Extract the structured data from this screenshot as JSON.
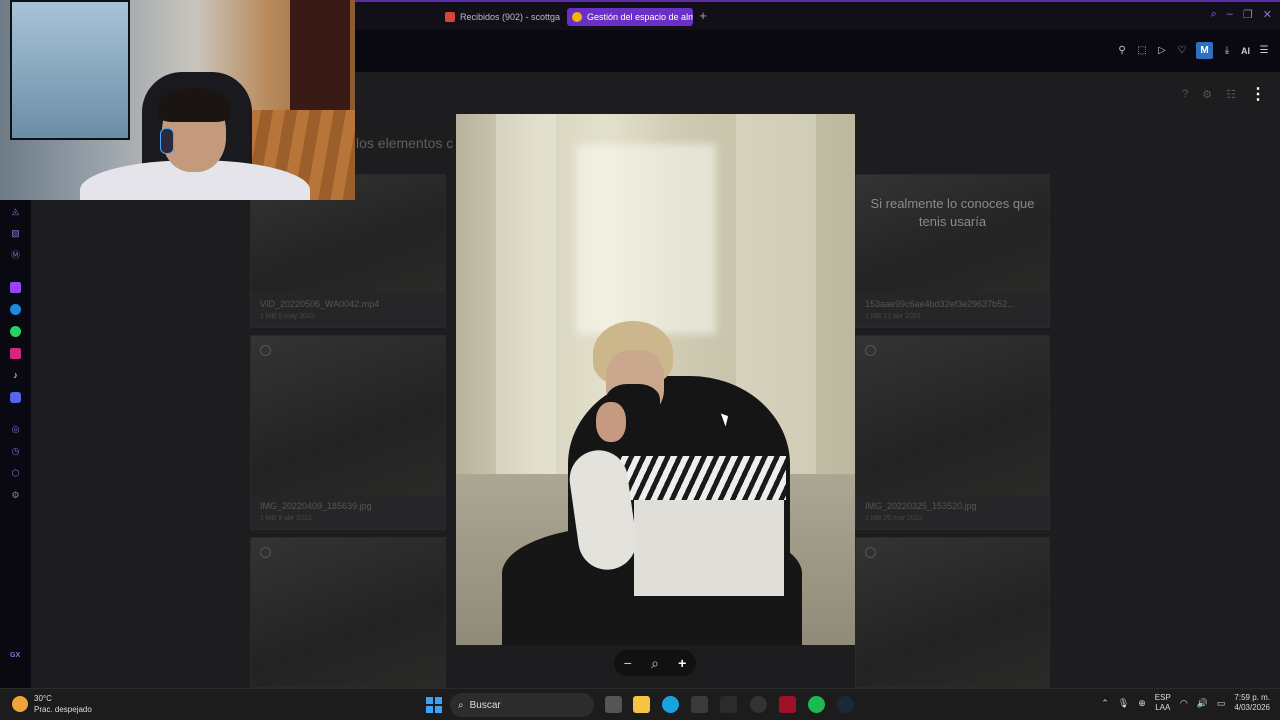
{
  "browser": {
    "tabs": [
      {
        "label": "Recibidos (902) - scottga",
        "icon": "gmail-icon"
      },
      {
        "label": "Gestión del espacio de alm",
        "icon": "drive-icon",
        "active": true
      }
    ],
    "new_tab_label": "+",
    "ai_label": "AI",
    "profile_initial": "M",
    "accent_color": "#6a2fc4"
  },
  "sidebar": {
    "gx_label": "GX",
    "items": [
      "aria-icon",
      "gx-corner-icon",
      "m-icon",
      "twitch-icon",
      "messenger-icon",
      "whatsapp-icon",
      "instagram-icon",
      "tiktok-icon",
      "discord-icon",
      "player-icon",
      "history-icon",
      "extensions-icon",
      "settings-icon"
    ]
  },
  "page": {
    "section_label": "los elementos c",
    "tiles": [
      {
        "name": "VID_20220506_WA0042.mp4",
        "meta": "1 MB 6 may 2022"
      },
      {
        "name": "IMG_20220409_185639.jpg",
        "meta": "1 MB 9 abr 2022"
      },
      {
        "name": "",
        "meta": ""
      },
      {
        "name": "153aae99c6ae4bd32ef3e29637b52...",
        "meta": "1 MB 13 abr 2022",
        "caption": "Si realmente lo conoces que tenis usaría"
      },
      {
        "name": "IMG_20220325_153520.jpg",
        "meta": "1 MB 25 mar 2022"
      },
      {
        "name": "",
        "meta": ""
      }
    ]
  },
  "viewer": {
    "zoom_out_label": "−",
    "zoom_in_label": "+"
  },
  "taskbar": {
    "weather_temp": "30°C",
    "weather_desc": "Prac. despejado",
    "search_placeholder": "Buscar",
    "lang_top": "ESP",
    "lang_bottom": "LAA",
    "time": "7:59 p. m.",
    "date": "4/03/2026"
  }
}
